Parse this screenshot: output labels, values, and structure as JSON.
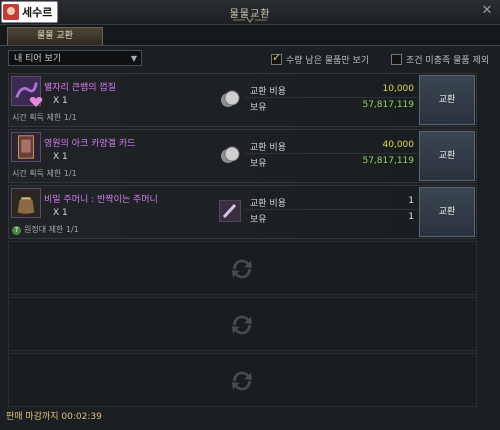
{
  "window": {
    "title": "물물교환",
    "close_icon": "close-icon"
  },
  "user": {
    "name": "세수르"
  },
  "tabs": [
    {
      "label": "물물 교환",
      "active": true
    }
  ],
  "filter": {
    "tier_select": "내 티어 보기",
    "show_remaining": {
      "label": "수량 남은 물품만 보기",
      "checked": true
    },
    "exclude_unmet": {
      "label": "조건 미충족 물품 제외",
      "checked": false
    }
  },
  "items": [
    {
      "name": "별자리 큰뱀의 껍질",
      "qty": "X 1",
      "limit": "시간 획득 제한 1/1",
      "cost_label": "교환 비용",
      "cost_value": "10,000",
      "cost_color": "#e6d45a",
      "own_label": "보유",
      "own_value": "57,817,119",
      "own_color": "#8fd16b",
      "button": "교환"
    },
    {
      "name": "영원의 아크 카양겔 카드",
      "qty": "X 1",
      "limit": "시간 획득 제한 1/1",
      "cost_label": "교환 비용",
      "cost_value": "40,000",
      "cost_color": "#e6d45a",
      "own_label": "보유",
      "own_value": "57,817,119",
      "own_color": "#8fd16b",
      "button": "교환"
    },
    {
      "name": "비밀 주머니 : 반짝이는 주머니",
      "qty": "X 1",
      "limit": "원정대 제한 1/1",
      "cost_label": "교환 비용",
      "cost_value": "1",
      "cost_color": "#e8e8e8",
      "own_label": "보유",
      "own_value": "1",
      "own_color": "#e8e8e8",
      "button": "교환"
    }
  ],
  "footer": {
    "timer": "판매 마감까지 00:02:39"
  }
}
